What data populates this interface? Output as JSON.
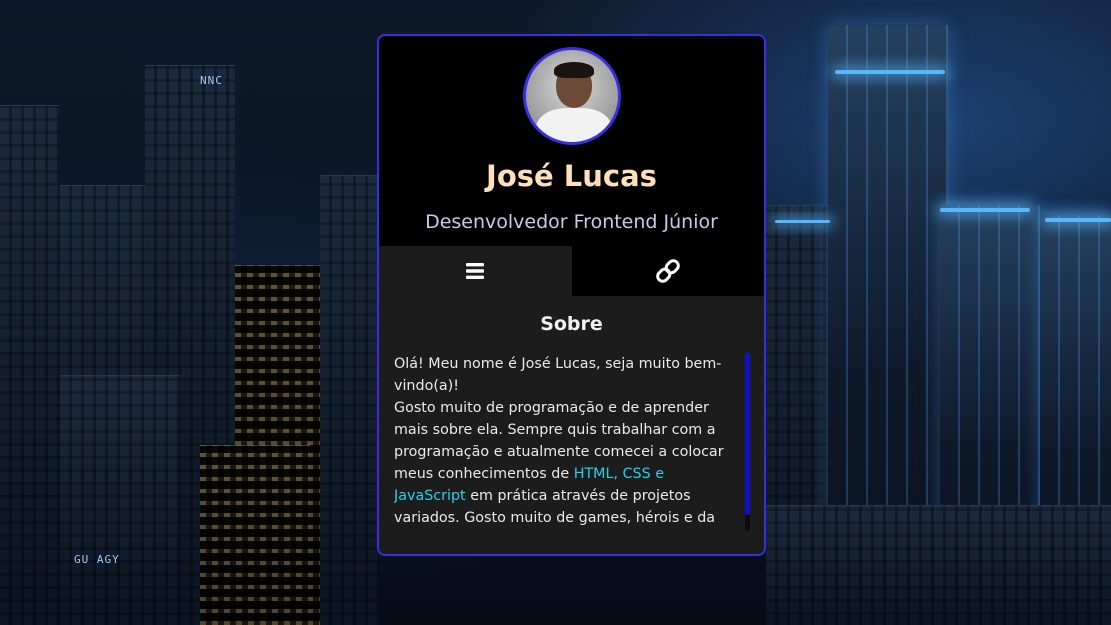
{
  "profile": {
    "name": "José Lucas",
    "role": "Desenvolvedor Frontend Júnior",
    "avatar_alt": "foto de perfil"
  },
  "tabs": [
    {
      "icon": "menu-icon",
      "active": true
    },
    {
      "icon": "link-icon",
      "active": false
    }
  ],
  "about": {
    "title": "Sobre",
    "line1": "Olá! Meu nome é José Lucas, seja muito bem-vindo(a)!",
    "line2_a": "Gosto muito de programação e de aprender mais sobre ela. Sempre quis trabalhar com a programação e atualmente comecei a colocar meus conhecimentos de ",
    "line2_hl": "HTML, CSS e JavaScript",
    "line2_b": " em prática através de projetos variados. Gosto muito de games, hérois e da"
  },
  "background": {
    "sign_left": "NNC",
    "sign_bottom": "GU AGY"
  },
  "colors": {
    "accent": "#3a2fe0",
    "name": "#ffe0ba",
    "highlight": "#22d3f0",
    "scrollbar": "#1010c8"
  }
}
